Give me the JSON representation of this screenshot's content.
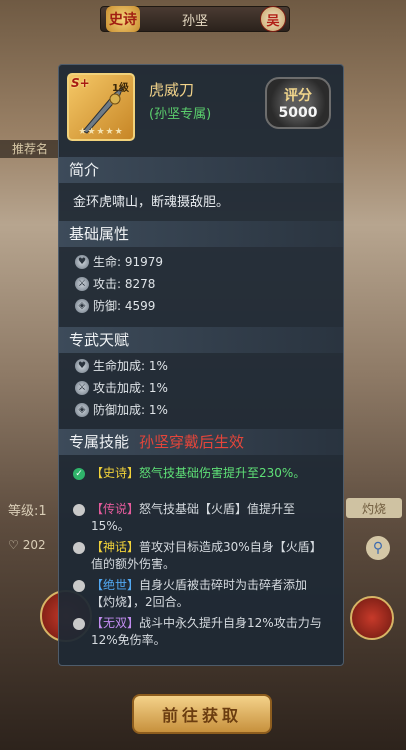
{
  "background": {
    "quality_tag": "史诗",
    "hero_name": "孙坚",
    "faction": "吴",
    "recommend_label": "推荐名",
    "level_label": "等级:1",
    "scorch_tag": "灼烧",
    "power_value": "202",
    "fetch_button": "前往获取"
  },
  "item": {
    "grade": "S+",
    "level": "1级",
    "name": "虎威刀",
    "owner": "(孙坚专属)",
    "stars": "★★★★★",
    "score_label": "评分",
    "score_value": "5000"
  },
  "sections": {
    "intro": {
      "title": "简介",
      "text": "金环虎啸山，断魂摄敌胆。"
    },
    "base_attrs": {
      "title": "基础属性",
      "items": [
        {
          "label": "生命: 91979",
          "icon": "heart-icon"
        },
        {
          "label": "攻击: 8278",
          "icon": "sword-icon"
        },
        {
          "label": "防御: 4599",
          "icon": "shield-icon"
        }
      ]
    },
    "talent": {
      "title": "专武天赋",
      "items": [
        {
          "label": "生命加成: 1%",
          "icon": "heart-icon"
        },
        {
          "label": "攻击加成: 1%",
          "icon": "sword-icon"
        },
        {
          "label": "防御加成: 1%",
          "icon": "shield-icon"
        }
      ]
    },
    "skills": {
      "title": "专属技能",
      "subtitle": "孙坚穿戴后生效",
      "items": [
        {
          "tag": "【史诗】",
          "text": "怒气技基础伤害提升至230%。",
          "active": true
        },
        {
          "tag": "【传说】",
          "text": "怒气技基础【火盾】值提升至15%。",
          "active": false
        },
        {
          "tag": "【神话】",
          "text": "普攻对目标造成30%自身【火盾】值的额外伤害。",
          "active": false
        },
        {
          "tag": "【绝世】",
          "text": "自身火盾被击碎时为击碎者添加【灼烧】，2回合。",
          "active": false
        },
        {
          "tag": "【无双】",
          "text": "战斗中永久提升自身12%攻击力与12%免伤率。",
          "active": false
        }
      ]
    }
  },
  "colors": {
    "panel_bg": "#1e2834",
    "active_green": "#5fe077",
    "accent_red": "#e5453a",
    "gold": "#f2d38a"
  }
}
